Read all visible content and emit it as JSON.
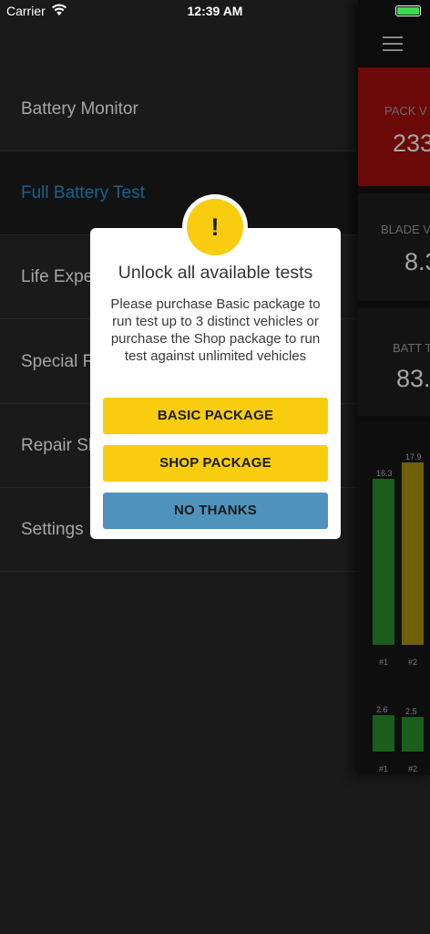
{
  "status_bar": {
    "carrier": "Carrier",
    "time": "12:39 AM"
  },
  "menu": {
    "items": [
      {
        "label": "Battery Monitor",
        "active": false
      },
      {
        "label": "Full Battery Test",
        "active": true
      },
      {
        "label": "Life Expe",
        "active": false
      },
      {
        "label": "Special F",
        "active": false
      },
      {
        "label": "Repair Sh",
        "active": false
      },
      {
        "label": "Settings",
        "active": false
      }
    ]
  },
  "main": {
    "cards": [
      {
        "label": "PACK V",
        "value": "233",
        "style": "red"
      },
      {
        "label": "BLADE V",
        "value": "8.3",
        "style": "dark"
      },
      {
        "label": "BATT T",
        "value": "83.",
        "style": "dark"
      }
    ]
  },
  "chart_data": [
    {
      "type": "bar",
      "categories": [
        "#1",
        "#2"
      ],
      "values": [
        16.3,
        17.9
      ],
      "colors": [
        "#1f6a1f",
        "#7e6e0a"
      ]
    },
    {
      "type": "bar",
      "categories": [
        "#1",
        "#2"
      ],
      "values": [
        2.6,
        2.5
      ],
      "colors": [
        "#1f6a1f",
        "#1f6a1f"
      ]
    }
  ],
  "dialog": {
    "icon": "!",
    "title": "Unlock all available tests",
    "message": "Please purchase Basic package to run test up to 3 distinct vehicles or purchase the Shop package to run test against unlimited vehicles",
    "buttons": {
      "basic": "BASIC PACKAGE",
      "shop": "SHOP PACKAGE",
      "no_thanks": "NO THANKS"
    }
  },
  "colors": {
    "accent_yellow": "#f8cd10",
    "accent_blue": "#4f93bd",
    "active_menu_text": "#1e6fa0",
    "alert_red": "#7a0a0a"
  }
}
